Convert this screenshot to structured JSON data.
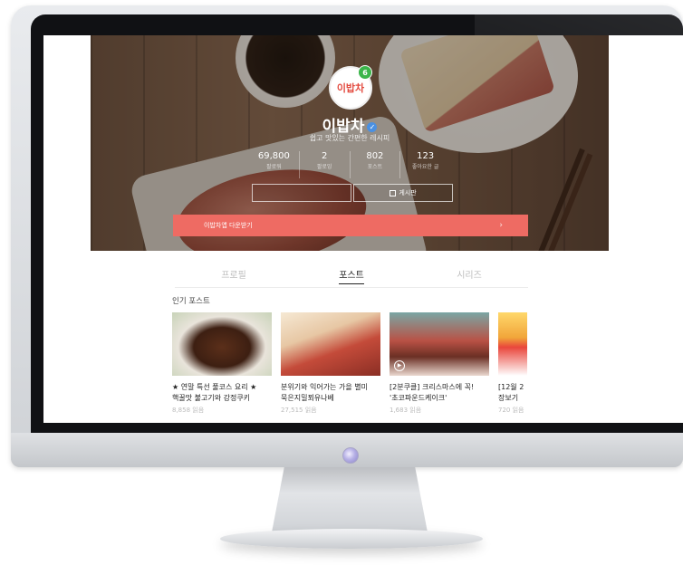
{
  "profile": {
    "logo_text": "이밥차",
    "badge": "6",
    "name": "이밥차",
    "description": "쉽고 맛있는 간편한 레시피",
    "stats": [
      {
        "value": "69,800",
        "label": "팔로워"
      },
      {
        "value": "2",
        "label": "팔로잉"
      },
      {
        "value": "802",
        "label": "포스트"
      },
      {
        "value": "123",
        "label": "좋아요한 글"
      }
    ],
    "board_button": "게시판",
    "download_label": "이밥차앱 다운받기"
  },
  "tabs": [
    "프로필",
    "포스트",
    "시리즈"
  ],
  "active_tab": "포스트",
  "section_title": "인기 포스트",
  "posts": [
    {
      "line1": "★ 연말 특선 풀코스 요리 ★",
      "line2": "핵꿀맛 불고기와 강정쿠키",
      "views": "8,858 읽음"
    },
    {
      "line1": "분위기와 익어가는 가을 별미",
      "line2": "묵은지밀푀유나베",
      "views": "27,515 읽음"
    },
    {
      "line1": "[2분쿠클] 크리스마스에 꼭!",
      "line2": "'초코파운드케이크'",
      "views": "1,683 읽음"
    },
    {
      "line1": "[12월 2",
      "line2": "장보기",
      "views": "720 읽음"
    }
  ],
  "colors": {
    "accent": "#ee6b63",
    "brand": "#e34a3f",
    "verified": "#4a90e2"
  }
}
